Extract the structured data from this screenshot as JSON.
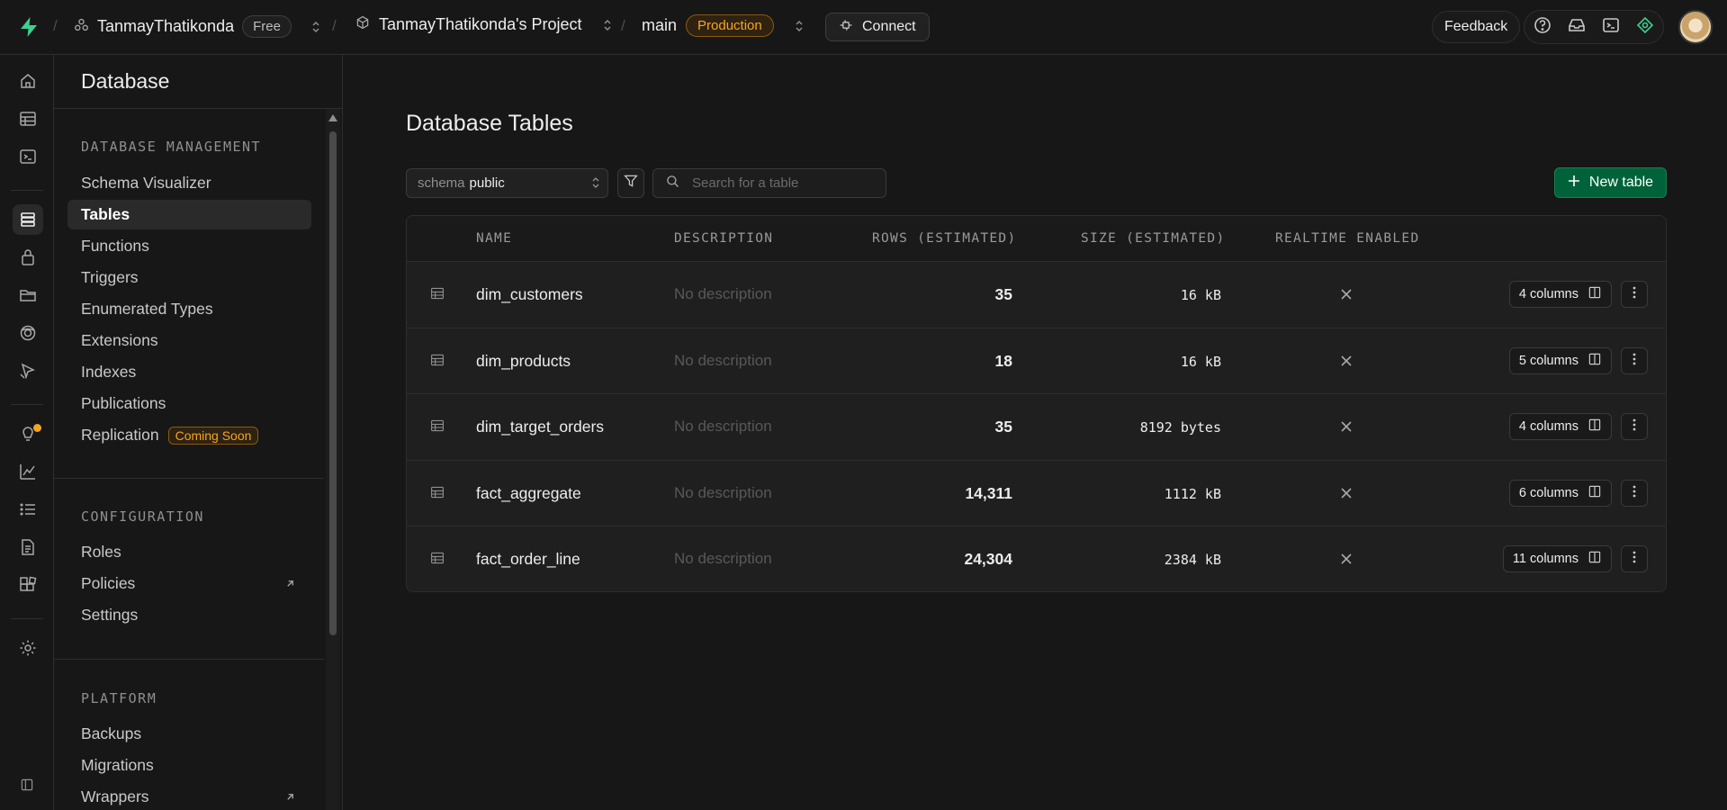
{
  "topbar": {
    "org_name": "TanmayThatikonda",
    "plan_badge": "Free",
    "project_name": "TanmayThatikonda's Project",
    "branch_name": "main",
    "env_badge": "Production",
    "connect_label": "Connect",
    "feedback_label": "Feedback",
    "separator": "/"
  },
  "panel": {
    "title": "Database",
    "sections": [
      {
        "title": "Database Management",
        "items": [
          {
            "label": "Schema Visualizer"
          },
          {
            "label": "Tables"
          },
          {
            "label": "Functions"
          },
          {
            "label": "Triggers"
          },
          {
            "label": "Enumerated Types"
          },
          {
            "label": "Extensions"
          },
          {
            "label": "Indexes"
          },
          {
            "label": "Publications"
          },
          {
            "label": "Replication",
            "badge": "Coming Soon"
          }
        ]
      },
      {
        "title": "Configuration",
        "items": [
          {
            "label": "Roles"
          },
          {
            "label": "Policies"
          },
          {
            "label": "Settings"
          }
        ]
      },
      {
        "title": "Platform",
        "items": [
          {
            "label": "Backups"
          },
          {
            "label": "Migrations"
          },
          {
            "label": "Wrappers"
          }
        ]
      }
    ]
  },
  "main": {
    "title": "Database Tables",
    "schema_prefix": "schema",
    "schema_value": "public",
    "search_placeholder": "Search for a table",
    "new_table_label": "New table",
    "columns": [
      "Name",
      "Description",
      "Rows (Estimated)",
      "Size (Estimated)",
      "Realtime Enabled"
    ],
    "rows": [
      {
        "name": "dim_customers",
        "description": "No description",
        "rows": "35",
        "size": "16 kB",
        "columns": "4 columns"
      },
      {
        "name": "dim_products",
        "description": "No description",
        "rows": "18",
        "size": "16 kB",
        "columns": "5 columns"
      },
      {
        "name": "dim_target_orders",
        "description": "No description",
        "rows": "35",
        "size": "8192 bytes",
        "columns": "4 columns"
      },
      {
        "name": "fact_aggregate",
        "description": "No description",
        "rows": "14,311",
        "size": "1112 kB",
        "columns": "6 columns"
      },
      {
        "name": "fact_order_line",
        "description": "No description",
        "rows": "24,304",
        "size": "2384 kB",
        "columns": "11 columns"
      }
    ]
  },
  "colors": {
    "brand_green": "#3ecf8e",
    "primary_button": "#006239",
    "warning_orange": "#f5a524",
    "background": "#171717"
  }
}
